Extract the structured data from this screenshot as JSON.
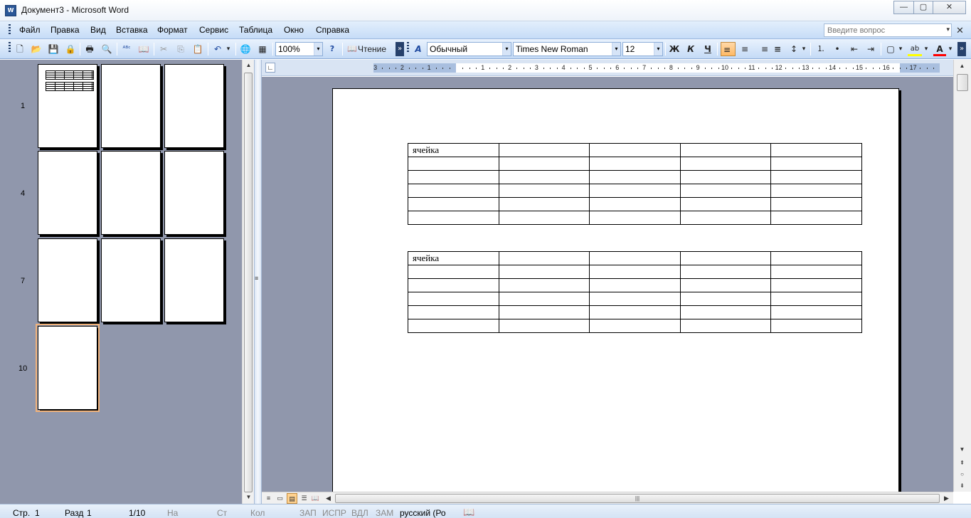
{
  "window": {
    "title": "Документ3 - Microsoft Word",
    "app_icon_text": "W",
    "minimize_glyph": "—",
    "maximize_glyph": "▢",
    "close_glyph": "✕"
  },
  "menu": {
    "items": [
      "Файл",
      "Правка",
      "Вид",
      "Вставка",
      "Формат",
      "Сервис",
      "Таблица",
      "Окно",
      "Справка"
    ],
    "ask_placeholder": "Введите вопрос",
    "ask_arrow": "▾",
    "close_glyph": "✕"
  },
  "toolbar": {
    "zoom": "100%",
    "read_button": "Чтение",
    "style": "Обычный",
    "font": "Times New Roman",
    "size": "12",
    "bold": "Ж",
    "italic": "К",
    "underline": "Ч",
    "icons": {
      "new": "🗋",
      "open": "📂",
      "save": "💾",
      "permission": "🔒",
      "print": "🖶",
      "preview": "🔍",
      "spelling": "ᴬᴮᶜ",
      "research": "📖",
      "cut": "✂",
      "copy": "⎘",
      "paste": "📋",
      "undo": "↶",
      "hyperlink": "🌐",
      "table": "▦",
      "help": "?",
      "styles": "A",
      "align_left": "≡",
      "center": "≡",
      "align_right": "≡",
      "justify": "≡",
      "line_spacing": "↕",
      "numbering": "⒈",
      "bullets": "•",
      "decrease_indent": "⇤",
      "increase_indent": "⇥",
      "borders": "▢",
      "highlight": "ab",
      "font_color": "A",
      "dropdown": "▾",
      "overflow": "»"
    }
  },
  "thumbnails": {
    "page_numbers": [
      "1",
      "4",
      "7",
      "10"
    ]
  },
  "ruler": {
    "numbers": [
      "3",
      "2",
      "1",
      "1",
      "2",
      "3",
      "4",
      "5",
      "6",
      "7",
      "8",
      "9",
      "10",
      "11",
      "12",
      "13",
      "14",
      "15",
      "16",
      "17"
    ],
    "corner": "∟"
  },
  "document": {
    "table1": [
      [
        "ячейка",
        "",
        "",
        "",
        ""
      ],
      [
        "",
        "",
        "",
        "",
        ""
      ],
      [
        "",
        "",
        "",
        "",
        ""
      ],
      [
        "",
        "",
        "",
        "",
        ""
      ],
      [
        "",
        "",
        "",
        "",
        ""
      ],
      [
        "",
        "",
        "",
        "",
        ""
      ]
    ],
    "table2": [
      [
        "ячейка",
        "",
        "",
        "",
        ""
      ],
      [
        "",
        "",
        "",
        "",
        ""
      ],
      [
        "",
        "",
        "",
        "",
        ""
      ],
      [
        "",
        "",
        "",
        "",
        ""
      ],
      [
        "",
        "",
        "",
        "",
        ""
      ],
      [
        "",
        "",
        "",
        "",
        ""
      ]
    ]
  },
  "scroll": {
    "up": "▲",
    "down": "▼",
    "prev_page": "⇞",
    "select_browse": "○",
    "next_page": "⇟",
    "left": "◀",
    "right": "▶",
    "grip": "|||",
    "vgrip": "≡"
  },
  "views": {
    "normal": "≡",
    "web": "▭",
    "print": "▤",
    "outline": "☰",
    "reading": "📖"
  },
  "status": {
    "page": "Стр.",
    "page_val": "1",
    "section": "Разд",
    "section_val": "1",
    "pages": "1/10",
    "at": "На",
    "line": "Ст",
    "col": "Кол",
    "rec": "ЗАП",
    "trk": "ИСПР",
    "ext": "ВДЛ",
    "ovr": "ЗАМ",
    "language": "русский (Ро",
    "spell_icon": "📖"
  }
}
